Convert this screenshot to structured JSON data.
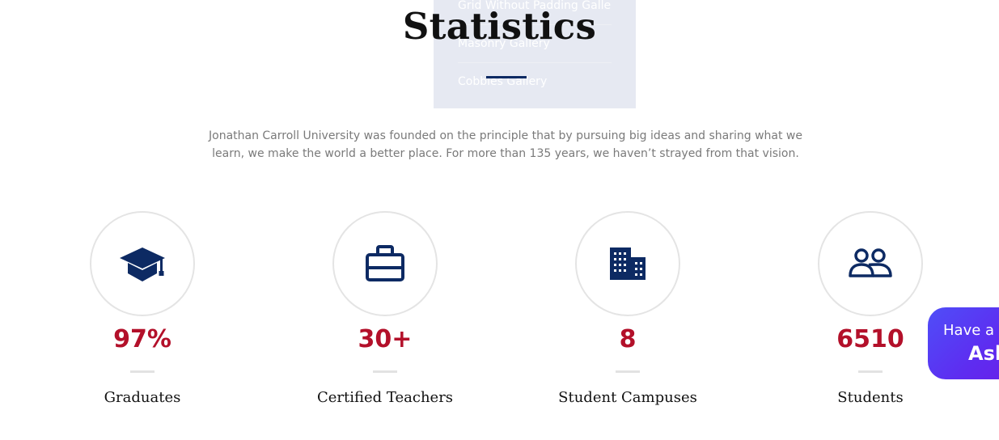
{
  "dropdown": {
    "items": [
      "Grid Without Padding Gallery",
      "Masonry Gallery",
      "Cobbles Gallery"
    ]
  },
  "section": {
    "title": "Statistics",
    "intro": "Jonathan Carroll University was founded on the principle that by pursuing big ideas and sharing what we learn, we make the world a better place. For more than 135 years, we haven’t strayed from that vision."
  },
  "stats": [
    {
      "icon": "graduation-cap-icon",
      "value": "97%",
      "label": "Graduates"
    },
    {
      "icon": "briefcase-icon",
      "value": "30+",
      "label": "Certified Teachers"
    },
    {
      "icon": "building-icon",
      "value": "8",
      "label": "Student Campuses"
    },
    {
      "icon": "users-icon",
      "value": "6510",
      "label": "Students"
    }
  ],
  "chat_widget": {
    "line1": "Have a q",
    "line2": "Ask"
  },
  "colors": {
    "accent_navy": "#0d2a63",
    "value_red": "#b3102a",
    "chat_gradient_start": "#4f4ef8",
    "chat_gradient_end": "#6a1ee8"
  }
}
